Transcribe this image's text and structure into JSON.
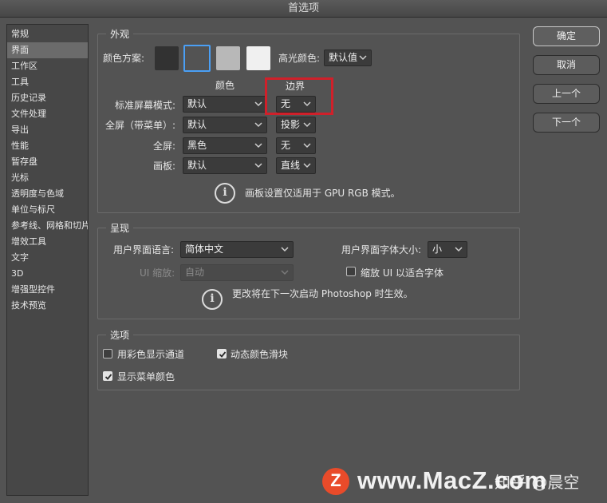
{
  "window": {
    "title": "首选项"
  },
  "sidebar": {
    "items": [
      {
        "label": "常规"
      },
      {
        "label": "界面"
      },
      {
        "label": "工作区"
      },
      {
        "label": "工具"
      },
      {
        "label": "历史记录"
      },
      {
        "label": "文件处理"
      },
      {
        "label": "导出"
      },
      {
        "label": "性能"
      },
      {
        "label": "暂存盘"
      },
      {
        "label": "光标"
      },
      {
        "label": "透明度与色域"
      },
      {
        "label": "单位与标尺"
      },
      {
        "label": "参考线、网格和切片"
      },
      {
        "label": "增效工具"
      },
      {
        "label": "文字"
      },
      {
        "label": "3D"
      },
      {
        "label": "增强型控件"
      },
      {
        "label": "技术预览"
      }
    ],
    "active_index": 1
  },
  "appearance": {
    "group_title": "外观",
    "color_scheme_label": "颜色方案:",
    "color_schemes": [
      "#323232",
      "#535353",
      "#b8b8b8",
      "#f0f0f0"
    ],
    "selected_scheme_index": 1,
    "highlight_color_label": "高光颜色:",
    "highlight_color_value": "默认值",
    "col_color": "颜色",
    "col_border": "边界",
    "rows": [
      {
        "label": "标准屏幕模式:",
        "color": "默认",
        "border": "无"
      },
      {
        "label": "全屏（带菜单）:",
        "color": "默认",
        "border": "投影"
      },
      {
        "label": "全屏:",
        "color": "黑色",
        "border": "无"
      },
      {
        "label": "画板:",
        "color": "默认",
        "border": "直线"
      }
    ],
    "note": "画板设置仅适用于 GPU RGB 模式。"
  },
  "presentation": {
    "group_title": "呈现",
    "ui_language_label": "用户界面语言:",
    "ui_language_value": "简体中文",
    "ui_font_size_label": "用户界面字体大小:",
    "ui_font_size_value": "小",
    "ui_scale_label": "UI 缩放:",
    "ui_scale_value": "自动",
    "scale_to_font_label": "缩放 UI 以适合字体",
    "scale_to_font_checked": false,
    "note": "更改将在下一次启动 Photoshop 时生效。"
  },
  "options": {
    "group_title": "选项",
    "color_channels_label": "用彩色显示通道",
    "color_channels_checked": false,
    "dynamic_sliders_label": "动态颜色滑块",
    "dynamic_sliders_checked": true,
    "menu_colors_label": "显示菜单颜色",
    "menu_colors_checked": true
  },
  "buttons": {
    "ok": "确定",
    "cancel": "取消",
    "prev": "上一个",
    "next": "下一个"
  },
  "watermark": {
    "logo_letter": "Z",
    "site": "www.MacZ.com",
    "zhihu": "知乎 @晨空"
  },
  "colors": {
    "accent": "#4a9ff5",
    "annotation_red": "#d0202a"
  }
}
